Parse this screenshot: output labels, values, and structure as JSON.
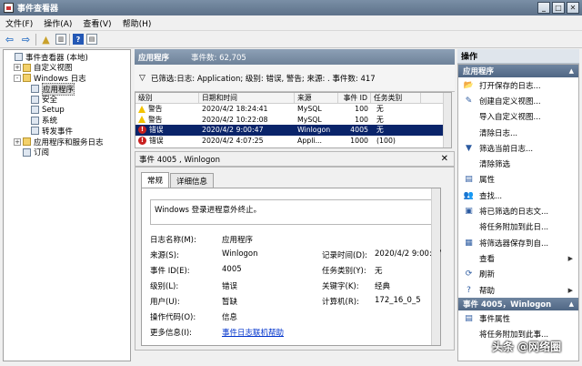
{
  "window": {
    "title": "事件查看器"
  },
  "menu": [
    "文件(F)",
    "操作(A)",
    "查看(V)",
    "帮助(H)"
  ],
  "tree": [
    {
      "label": "事件查看器 (本地)",
      "toggle": "",
      "icon": "monitor",
      "level": 0
    },
    {
      "label": "自定义视图",
      "toggle": "+",
      "icon": "folder",
      "level": 1
    },
    {
      "label": "Windows 日志",
      "toggle": "-",
      "icon": "folder",
      "level": 1
    },
    {
      "label": "应用程序",
      "toggle": "",
      "icon": "log",
      "level": 2,
      "selected": true
    },
    {
      "label": "安全",
      "toggle": "",
      "icon": "log",
      "level": 2
    },
    {
      "label": "Setup",
      "toggle": "",
      "icon": "log",
      "level": 2
    },
    {
      "label": "系统",
      "toggle": "",
      "icon": "log",
      "level": 2
    },
    {
      "label": "转发事件",
      "toggle": "",
      "icon": "log",
      "level": 2
    },
    {
      "label": "应用程序和服务日志",
      "toggle": "+",
      "icon": "folder",
      "level": 1
    },
    {
      "label": "订阅",
      "toggle": "",
      "icon": "log",
      "level": 1
    }
  ],
  "middle": {
    "title": "应用程序",
    "count_label": "事件数: 62,705"
  },
  "filter": {
    "text": "已筛选:日志: Application; 级别: 错误, 警告; 来源: . 事件数: 417"
  },
  "grid": {
    "headers": [
      "级别",
      "日期和时间",
      "来源",
      "事件 ID",
      "任务类别"
    ],
    "rows": [
      {
        "level": "警告",
        "type": "warn",
        "datetime": "2020/4/2 18:24:41",
        "source": "MySQL",
        "id": "100",
        "category": "无"
      },
      {
        "level": "警告",
        "type": "warn",
        "datetime": "2020/4/2 10:22:08",
        "source": "MySQL",
        "id": "100",
        "category": "无"
      },
      {
        "level": "错误",
        "type": "err",
        "datetime": "2020/4/2 9:00:47",
        "source": "Winlogon",
        "id": "4005",
        "category": "无",
        "selected": true
      },
      {
        "level": "错误",
        "type": "err",
        "datetime": "2020/4/2 4:07:25",
        "source": "Appli...",
        "id": "1000",
        "category": "(100)"
      }
    ]
  },
  "detail": {
    "header": "事件 4005 , Winlogon",
    "tabs": [
      "常规",
      "详细信息"
    ],
    "message": "Windows 登录进程意外终止。",
    "log_name_label": "日志名称(M):",
    "log_name": "应用程序",
    "source_label": "来源(S):",
    "source": "Winlogon",
    "logged_label": "记录时间(D):",
    "logged": "2020/4/2 9:00:47",
    "event_id_label": "事件 ID(E):",
    "event_id": "4005",
    "task_label": "任务类别(Y):",
    "task": "无",
    "level_label": "级别(L):",
    "level": "错误",
    "keywords_label": "关键字(K):",
    "keywords": "经典",
    "user_label": "用户(U):",
    "user": "暂缺",
    "computer_label": "计算机(R):",
    "computer": "172_16_0_5",
    "opcode_label": "操作代码(O):",
    "opcode": "信息",
    "more_label": "更多信息(I):",
    "more_link": "事件日志联机帮助"
  },
  "actions": {
    "title": "操作",
    "section1": "应用程序",
    "items1": [
      {
        "label": "打开保存的日志...",
        "icon": "open-folder-icon",
        "glyph": "📂",
        "sub": ""
      },
      {
        "label": "创建自定义视图...",
        "icon": "filter-create-icon",
        "glyph": "✎",
        "sub": ""
      },
      {
        "label": "导入自定义视图...",
        "icon": "import-icon",
        "glyph": "",
        "sub": ""
      },
      {
        "label": "清除日志...",
        "icon": "clear-icon",
        "glyph": "",
        "sub": ""
      },
      {
        "label": "筛选当前日志...",
        "icon": "filter-icon",
        "glyph": "▼",
        "sub": ""
      },
      {
        "label": "清除筛选",
        "icon": "clear-filter-icon",
        "glyph": "",
        "sub": ""
      },
      {
        "label": "属性",
        "icon": "properties-icon",
        "glyph": "▤",
        "sub": ""
      },
      {
        "label": "查找...",
        "icon": "find-icon",
        "glyph": "👥",
        "sub": ""
      },
      {
        "label": "将已筛选的日志文...",
        "icon": "save-icon",
        "glyph": "▣",
        "sub": ""
      },
      {
        "label": "将任务附加到此日...",
        "icon": "task-icon",
        "glyph": "",
        "sub": ""
      },
      {
        "label": "将筛选器保存到自...",
        "icon": "save-filter-icon",
        "glyph": "▦",
        "sub": ""
      },
      {
        "label": "查看",
        "icon": "view-icon",
        "glyph": "",
        "sub": "▶"
      },
      {
        "label": "刷新",
        "icon": "refresh-icon",
        "glyph": "⟳",
        "sub": ""
      },
      {
        "label": "帮助",
        "icon": "help-icon",
        "glyph": "?",
        "sub": "▶"
      }
    ],
    "section2": "事件 4005，Winlogon",
    "items2": [
      {
        "label": "事件属性",
        "icon": "event-properties-icon",
        "glyph": "▤",
        "sub": ""
      },
      {
        "label": "将任务附加到此事...",
        "icon": "attach-task-icon",
        "glyph": "",
        "sub": ""
      }
    ]
  },
  "watermark": "头条 @网络圈"
}
